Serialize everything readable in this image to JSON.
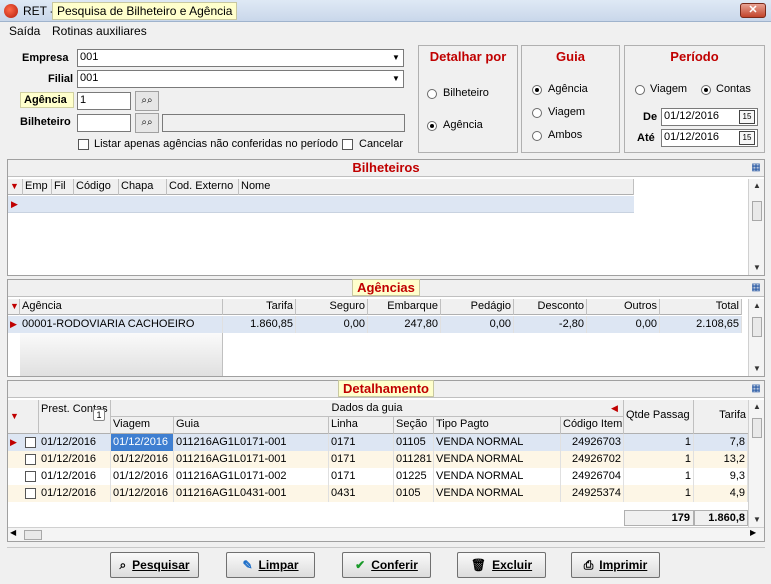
{
  "window": {
    "app_name": "RET -",
    "title": "Pesquisa de Bilheteiro e Agência",
    "close": "✕"
  },
  "menu": [
    "Saída",
    "Rotinas auxiliares"
  ],
  "form": {
    "empresa_label": "Empresa",
    "empresa_value": "001",
    "filial_label": "Filial",
    "filial_value": "001",
    "agencia_label": "Agência",
    "agencia_value": "1",
    "bilheteiro_label": "Bilheteiro",
    "bilheteiro_value": "",
    "listar_label": "Listar apenas agências não conferidas no período",
    "cancelar_label": "Cancelar"
  },
  "detalhar": {
    "title": "Detalhar por",
    "options": [
      "Bilheteiro",
      "Agência"
    ],
    "selected": "Agência"
  },
  "guia": {
    "title": "Guia",
    "options": [
      "Agência",
      "Viagem",
      "Ambos"
    ],
    "selected": "Agência"
  },
  "periodo": {
    "title": "Período",
    "options": [
      "Viagem",
      "Contas"
    ],
    "selected": "Contas",
    "de_label": "De",
    "de_value": "01/12/2016",
    "ate_label": "Até",
    "ate_value": "01/12/2016",
    "cal_icon": "15"
  },
  "bilheteiros": {
    "title": "Bilheteiros",
    "columns": [
      "Emp",
      "Fil",
      "Código",
      "Chapa",
      "Cod. Externo",
      "Nome"
    ]
  },
  "agencias": {
    "title": "Agências",
    "columns": [
      "Agência",
      "Tarifa",
      "Seguro",
      "Embarque",
      "Pedágio",
      "Desconto",
      "Outros",
      "Total"
    ],
    "rows": [
      [
        "00001-RODOVIARIA CACHOEIRO",
        "1.860,85",
        "0,00",
        "247,80",
        "0,00",
        "-2,80",
        "0,00",
        "2.108,65"
      ]
    ]
  },
  "detalhamento": {
    "title": "Detalhamento",
    "prest_label": "Prest. Contas",
    "sort_badge": "1",
    "dados_label": "Dados da guia",
    "columns": [
      "Viagem",
      "Guia",
      "Linha",
      "Seção",
      "Tipo Pagto",
      "Código Item",
      "Qtde Passag",
      "Tarifa"
    ],
    "rows": [
      [
        "01/12/2016",
        "01/12/2016",
        "011216AG1L0171-001",
        "0171",
        "01105",
        "VENDA NORMAL",
        "24926703",
        "1",
        "7,8"
      ],
      [
        "01/12/2016",
        "01/12/2016",
        "011216AG1L0171-001",
        "0171",
        "011281",
        "VENDA NORMAL",
        "24926702",
        "1",
        "13,2"
      ],
      [
        "01/12/2016",
        "01/12/2016",
        "011216AG1L0171-002",
        "0171",
        "01225",
        "VENDA NORMAL",
        "24926704",
        "1",
        "9,3"
      ],
      [
        "01/12/2016",
        "01/12/2016",
        "011216AG1L0431-001",
        "0431",
        "0105",
        "VENDA NORMAL",
        "24925374",
        "1",
        "4,9"
      ]
    ],
    "totals": {
      "qtde": "179",
      "tarifa": "1.860,8"
    }
  },
  "buttons": {
    "pesquisar": "Pesquisar",
    "limpar": "Limpar",
    "conferir": "Conferir",
    "excluir": "Excluir",
    "imprimir": "Imprimir"
  },
  "colors": {
    "accent_red": "#c00000",
    "hint_yellow": "#ffffcc",
    "selected_row": "#dde6f3"
  }
}
